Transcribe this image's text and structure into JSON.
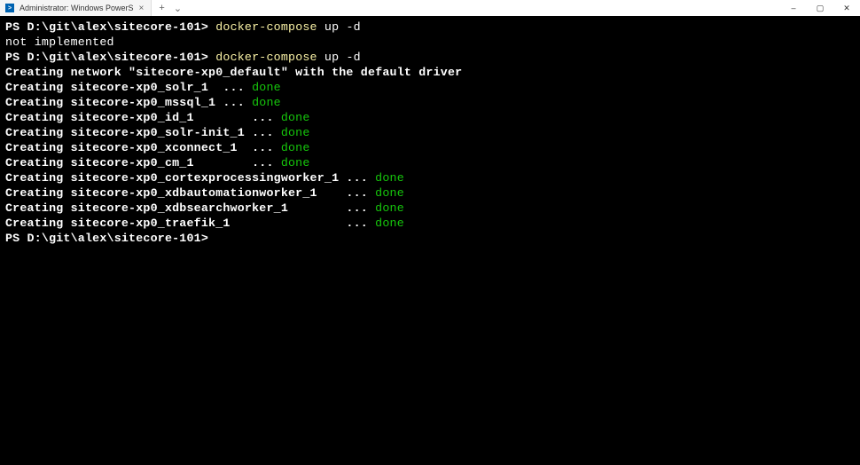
{
  "titlebar": {
    "tab_title": "Administrator: Windows PowerS",
    "tab_icon_char": ">",
    "close_x": "×",
    "plus": "+",
    "chevron": "⌄"
  },
  "window_controls": {
    "minimize": "–",
    "maximize": "▢",
    "close": "✕"
  },
  "terminal": {
    "prompt": "PS D:\\git\\alex\\sitecore-101>",
    "cmd_prefix": "docker-compose ",
    "cmd_up": "up ",
    "cmd_flag": "-d",
    "not_impl": "not implemented",
    "net_line": "Creating network \"sitecore-xp0_default\" with the default driver",
    "lines": [
      {
        "text": "Creating sitecore-xp0_solr_1  ... ",
        "done": true
      },
      {
        "text": "Creating sitecore-xp0_mssql_1 ... ",
        "done": true
      },
      {
        "text": "Creating sitecore-xp0_id_1        ... ",
        "done": true
      },
      {
        "text": "Creating sitecore-xp0_solr-init_1 ... ",
        "done": true
      },
      {
        "text": "Creating sitecore-xp0_xconnect_1  ... ",
        "done": true
      },
      {
        "text": "Creating sitecore-xp0_cm_1        ... ",
        "done": true
      },
      {
        "text": "Creating sitecore-xp0_cortexprocessingworker_1 ... ",
        "done": true
      },
      {
        "text": "Creating sitecore-xp0_xdbautomationworker_1    ... ",
        "done": true
      },
      {
        "text": "Creating sitecore-xp0_xdbsearchworker_1        ... ",
        "done": true
      },
      {
        "text": "Creating sitecore-xp0_traefik_1                ... ",
        "done": true
      }
    ],
    "done_label": "done"
  }
}
